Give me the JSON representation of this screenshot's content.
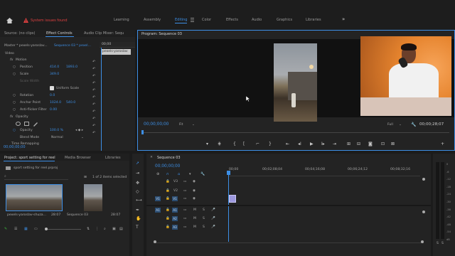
{
  "alert": {
    "text": "System issues found"
  },
  "workspaces": [
    "Learning",
    "Assembly",
    "Editing",
    "Color",
    "Effects",
    "Audio",
    "Graphics",
    "Libraries"
  ],
  "active_workspace": "Editing",
  "more_glyph": "»",
  "left_panel": {
    "tabs": [
      "Source: (no clips)",
      "Effect Controls",
      "Audio Clip Mixer: Sequ"
    ],
    "master_label": "Master * pexels-yaroslav...",
    "sequence_label": "Sequence 03 * pexel...",
    "ruler_time": "00;00",
    "clip_chip": "pexels-yaroslav",
    "section_video": "Video",
    "motion": "Motion",
    "position_label": "Position",
    "position_x": "414.0",
    "position_y": "1893.0",
    "scale_label": "Scale",
    "scale_value": "349.0",
    "scale_width_label": "Scale Width",
    "uniform_scale": "Uniform Scale",
    "rotation_label": "Rotation",
    "rotation_value": "0.0",
    "anchor_label": "Anchor Point",
    "anchor_x": "1024.0",
    "anchor_y": "540.0",
    "antiflicker_label": "Anti-flicker Filter",
    "antiflicker_value": "0.00",
    "opacity_section": "Opacity",
    "opacity_label": "Opacity",
    "opacity_value": "100.0 %",
    "blend_label": "Blend Mode",
    "blend_value": "Normal",
    "time_remap": "Time Remapping",
    "timecode": "00;00;00;00"
  },
  "program": {
    "title": "Program: Sequence 03",
    "timecode_left": "00;00;00;00",
    "fit": "Fit",
    "quality": "Full",
    "timecode_right": "00;00;28;07"
  },
  "project": {
    "tabs": [
      "Project: sport setting for reel",
      "Media Browser",
      "Libraries"
    ],
    "project_file": "sport setting for reel.prproj",
    "count": "1 of 2 items selected",
    "items": [
      {
        "name": "pexels-yaroslav-shuza...",
        "duration": "28:07"
      },
      {
        "name": "Sequence 03",
        "duration": "28:07"
      }
    ]
  },
  "timeline": {
    "tab": "Sequence 03",
    "timecode": "00;00;00;00",
    "ruler": [
      "00;00",
      "00;02;08;04",
      "00;04;16;08",
      "00;06;24;12",
      "00;08;32;16"
    ],
    "video_tracks": [
      "V3",
      "V2",
      "V1"
    ],
    "audio_tracks": [
      "A1",
      "A2",
      "A3"
    ],
    "source_patch_v": "V1",
    "source_patch_a": "A1",
    "mute": "M",
    "solo": "S"
  },
  "meter_labels": [
    "0",
    "-6",
    "-12",
    "-18",
    "-24",
    "-30",
    "-36",
    "-42",
    "-48",
    "-54",
    "dB"
  ],
  "colors": {
    "accent": "#3d8fe6",
    "alert": "#e04040",
    "clip_violet": "#9d98de"
  }
}
